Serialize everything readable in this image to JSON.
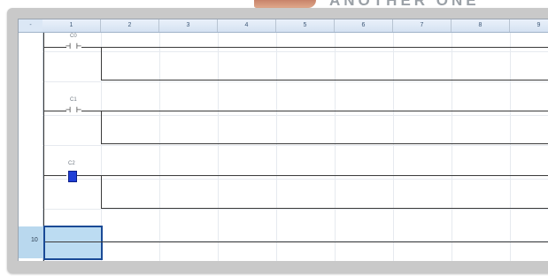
{
  "banner_text": "ANOTHER ONE",
  "grid": {
    "corner_label": "-",
    "columns": [
      "1",
      "2",
      "3",
      "4",
      "5",
      "6",
      "7",
      "8",
      "9"
    ]
  },
  "rungs": [
    {
      "contact_label": "C0",
      "contact_symbol": "⊣ ⊢"
    },
    {
      "contact_label": "C1",
      "contact_symbol": "⊣ ⊢"
    },
    {
      "contact_label": "C2",
      "contact_symbol": "⊣ ⊢"
    }
  ],
  "end_row": {
    "label": "10"
  },
  "colors": {
    "header_bg": "#d5e2f2",
    "selection": "#bcdcf2",
    "selection_border": "#1a4a96",
    "marker": "#1f3fd6"
  }
}
